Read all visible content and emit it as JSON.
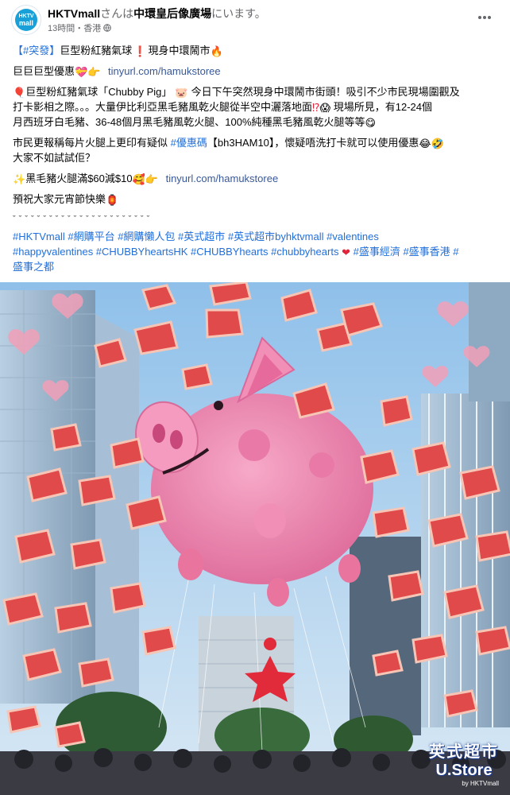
{
  "post": {
    "page_name": "HKTVmall",
    "checkin_pre": "さんは",
    "location": "中環皇后像廣場",
    "checkin_post": "にいます。",
    "time": "13時間",
    "sep": "・",
    "place": "香港",
    "avatar_text_1": "HKTV",
    "avatar_text_2": "mall"
  },
  "content": {
    "l1_hashtag": "【#突發】",
    "l1_text": "巨型粉紅豬氣球",
    "l1_text2": "現身中環鬧市",
    "l2_text": "巨巨巨型優惠",
    "l2_link": "tinyurl.com/hamukstoree",
    "p1_a": "巨型粉紅豬氣球「Chubby Pig」",
    "p1_b": "今日下午突然現身中環鬧市街頭！吸引不少市民現場圍觀及",
    "p1_c": "打卡影相之際。。。大量伊比利亞黑毛豬風乾火腿從半空中灑落地面",
    "p1_d": "現場所見，有12-24個",
    "p1_e": "月西班牙白毛豬、36-48個月黑毛豬風乾火腿、100%純種黑毛豬風乾火腿等等",
    "p2_a": "市民更報稱每片火腿上更印有疑似",
    "p2_tag": "#優惠碼",
    "p2_b": "【bh3HAM10】，懷疑唔洗打卡就可以使用優惠",
    "p2_c": "大家不如試試佢？",
    "p3_a": "黑毛豬火腿滿$60減$10",
    "p3_link": "tinyurl.com/hamukstoree",
    "p4": "預祝大家元宵節快樂",
    "dots": "ˇˇˇˇˇˇˇˇˇˇˇˇˇˇˇˇˇˇˇˇˇˇˇ",
    "tags1": "#HKTVmall #網購平台 #網購懶人包 #英式超市 #英式超市byhktvmall #valentines",
    "tags2a": "#happyvalentines #CHUBBYheartsHK #CHUBBYhearts #chubbyhearts",
    "tags2b": "#盛事經濟 #盛事香港 #",
    "tags3": "盛事之都"
  },
  "photo": {
    "logo_line1": "英式超市",
    "logo_line2": "U.Store",
    "logo_line3": "by HKTVmall"
  },
  "colors": {
    "link": "#385898",
    "hashtag": "#216fdb",
    "sky": "#9ec8ec",
    "pig": "#f08ab2"
  }
}
